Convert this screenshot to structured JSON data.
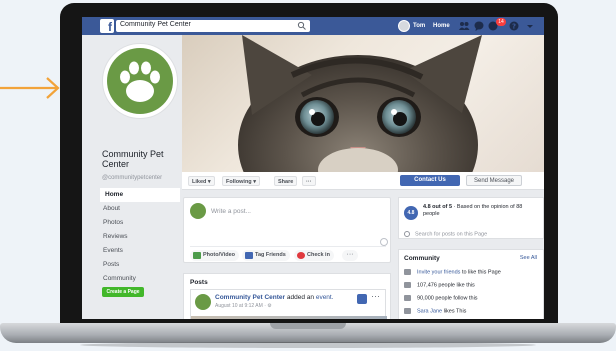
{
  "colors": {
    "fb_blue": "#3b5998",
    "button_blue": "#4267b2",
    "brand_green": "#6a9a45",
    "create_green": "#42b72a",
    "arrow_orange": "#f2a33a"
  },
  "topbar": {
    "search_value": "Community Pet Center",
    "user_name": "Tom",
    "home_label": "Home",
    "notification_count": "14"
  },
  "page": {
    "name": "Community Pet Center",
    "handle": "@communitypetcenter"
  },
  "nav": {
    "items": [
      {
        "label": "Home"
      },
      {
        "label": "About"
      },
      {
        "label": "Photos"
      },
      {
        "label": "Reviews"
      },
      {
        "label": "Events"
      },
      {
        "label": "Posts"
      },
      {
        "label": "Community"
      }
    ],
    "create_page_label": "Create a Page"
  },
  "action_bar": {
    "liked_label": "Liked ▾",
    "following_label": "Following ▾",
    "share_label": "Share",
    "more_label": "···",
    "contact_label": "Contact Us",
    "send_label": "Send Message"
  },
  "composer": {
    "placeholder": "Write a post...",
    "photo_video_label": "Photo/Video",
    "tag_friends_label": "Tag Friends",
    "check_in_label": "Check in",
    "more_label": "···"
  },
  "posts": {
    "title": "Posts",
    "post": {
      "author": "Community Pet Center",
      "action": "added an",
      "object": "event.",
      "meta": "August 10 at 9:12 AM · ⚙"
    }
  },
  "rating": {
    "score": "4.8",
    "headline": "4.8 out of 5",
    "detail": " · Based on the opinion of 88 people"
  },
  "search_posts_placeholder": "Search for posts on this Page",
  "community": {
    "title": "Community",
    "see_all": "See All",
    "invite_link": "Invite your friends",
    "invite_suffix": " to like this Page",
    "likes": "107,476 people like this",
    "follows": "90,000 people follow this",
    "sara_link": "Sara Jane",
    "sara_suffix": " likes This"
  }
}
